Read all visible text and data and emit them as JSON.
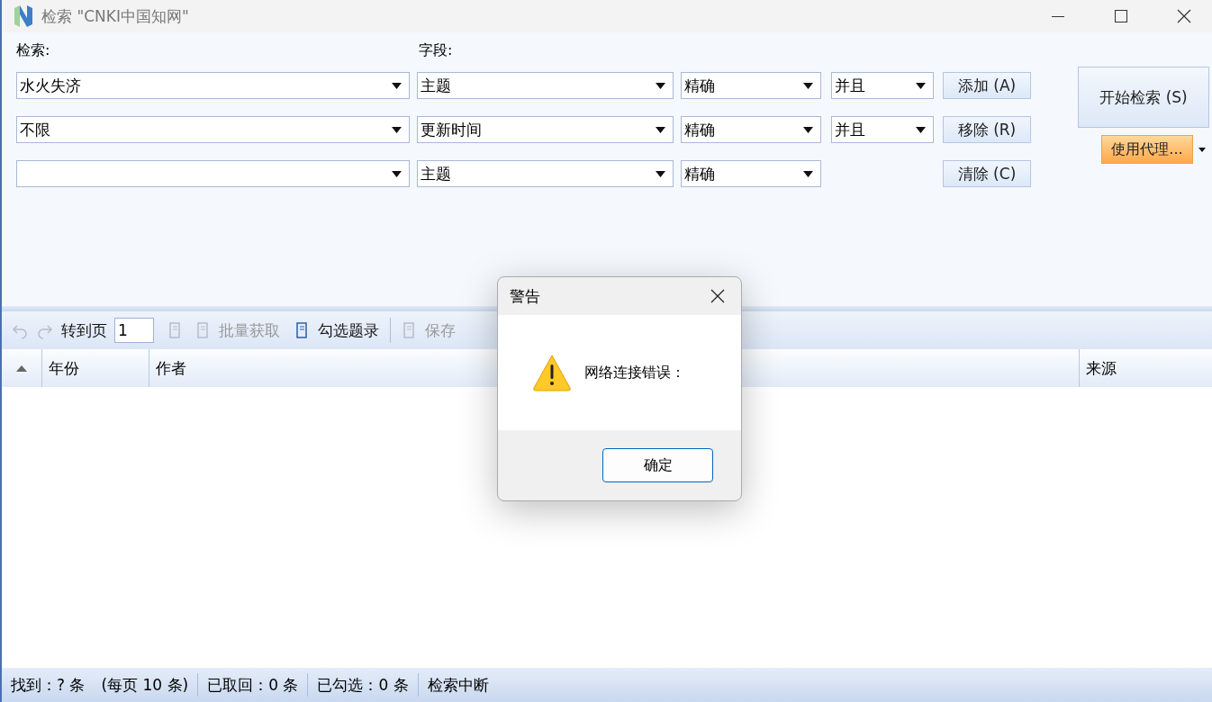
{
  "window": {
    "title": "检索 \"CNKI中国知网\""
  },
  "search_form": {
    "query_label": "检索:",
    "field_label": "字段:",
    "rows": [
      {
        "query": "水火失济",
        "field": "主题",
        "match": "精确",
        "logic": "并且"
      },
      {
        "query": "不限",
        "field": "更新时间",
        "match": "精确",
        "logic": "并且"
      },
      {
        "query": "",
        "field": "主题",
        "match": "精确"
      }
    ],
    "buttons": [
      "添加 (A)",
      "移除 (R)",
      "清除 (C)"
    ],
    "start_button": "开始检索 (S)",
    "proxy_button": "使用代理..."
  },
  "toolbar": {
    "goto_label": "转到页",
    "page": "1",
    "items": [
      {
        "label": "批量获取",
        "disabled": true
      },
      {
        "label": "勾选题录",
        "disabled": false
      },
      {
        "label": "保存",
        "disabled": true
      }
    ]
  },
  "table": {
    "columns": [
      "年份",
      "作者",
      "来源"
    ]
  },
  "status_bar": [
    {
      "texts": [
        "找到：? 条",
        "(每页 10 条)"
      ]
    },
    {
      "texts": [
        "已取回：0 条"
      ]
    },
    {
      "texts": [
        "已勾选：0 条"
      ]
    },
    {
      "texts": [
        "检索中断"
      ]
    }
  ],
  "dialog": {
    "title": "警告",
    "message": "网络连接错误：",
    "button": "确定"
  }
}
